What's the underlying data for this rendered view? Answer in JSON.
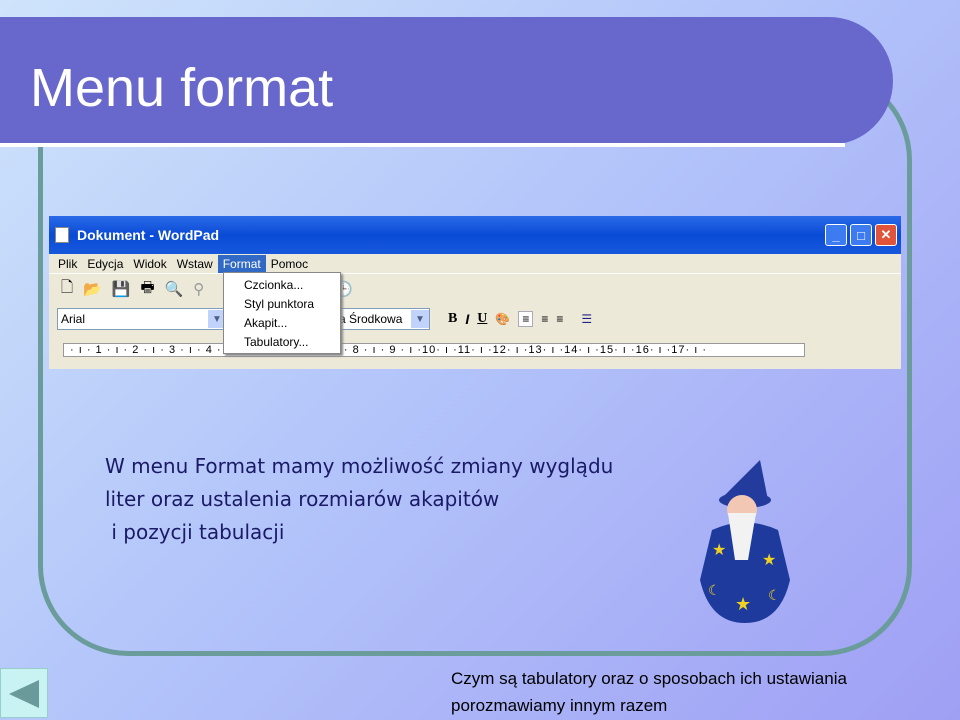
{
  "slide": {
    "title": "Menu format",
    "body_lines": [
      "W menu Format mamy możliwość zmiany wyglądu",
      "liter oraz ustalenia rozmiarów akapitów",
      " i pozycji tabulacji"
    ],
    "note_lines": [
      "Czym są tabulatory oraz o sposobach ich ustawiania",
      "porozmawiamy innym razem"
    ],
    "back_icon": "triangle-left-icon"
  },
  "wordpad": {
    "title": "Dokument - WordPad",
    "menu": [
      "Plik",
      "Edycja",
      "Widok",
      "Wstaw",
      "Format",
      "Pomoc"
    ],
    "format_menu": [
      "Czcionka...",
      "Styl punktora",
      "Akapit...",
      "Tabulatory..."
    ],
    "font": "Arial",
    "script": "a Środkowa",
    "bold": "B",
    "italic": "I",
    "underline": "U",
    "ruler": "· ı · 1 · ı · 2 · ı · 3 · ı · 4 · ı · 5 · ı · 6 · ı · 7 · ı · 8 · ı · 9 · ı ·10· ı ·11· ı ·12· ı ·13· ı ·14· ı ·15· ı ·16· ı ·17· ı ·"
  }
}
